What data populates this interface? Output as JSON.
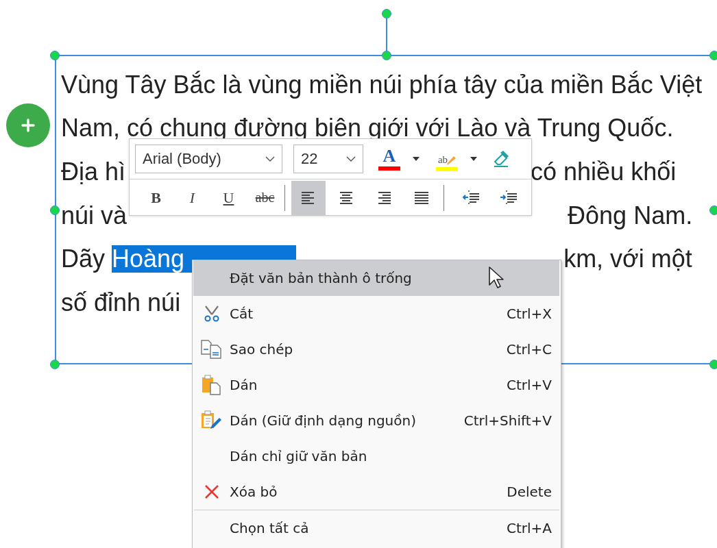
{
  "text_box": {
    "lines": [
      {
        "segments": [
          {
            "text": "Vùng Tây Bắc là vùng miền núi phía tây của miền Bắc Việt",
            "selected": false
          }
        ]
      },
      {
        "segments": [
          {
            "text": "Nam, có chung đường biên giới với Lào và Trung Quốc.",
            "selected": false
          }
        ]
      },
      {
        "segments": [
          {
            "text": "Địa hì",
            "selected": false
          },
          {
            "text": "có nhiều khối",
            "selected": false
          }
        ]
      },
      {
        "segments": [
          {
            "text": "núi và",
            "selected": false
          },
          {
            "text": "Đông Nam.",
            "selected": false
          }
        ]
      },
      {
        "segments": [
          {
            "text": "Dãy ",
            "selected": false
          },
          {
            "text": "Hoàng",
            "selected": true
          },
          {
            "text": "km, với một",
            "selected": false
          }
        ]
      },
      {
        "segments": [
          {
            "text": "số đỉnh núi",
            "selected": false
          }
        ]
      }
    ]
  },
  "toolbar": {
    "font": {
      "value": "Arial (Body)"
    },
    "size": {
      "value": "22"
    },
    "color_buttons": [
      {
        "kind": "font-color",
        "label": "A",
        "color": "#ff0000"
      },
      {
        "kind": "highlight",
        "label": "ab",
        "color": "#ffff00"
      },
      {
        "kind": "clear-format"
      }
    ],
    "format_buttons": [
      {
        "kind": "bold",
        "label": "B"
      },
      {
        "kind": "italic",
        "label": "I"
      },
      {
        "kind": "underline",
        "label": "U"
      },
      {
        "kind": "strikethrough",
        "label": "abc"
      }
    ],
    "align_buttons": [
      {
        "kind": "left",
        "selected": true
      },
      {
        "kind": "center",
        "selected": false
      },
      {
        "kind": "right",
        "selected": false
      },
      {
        "kind": "justify",
        "selected": false
      }
    ],
    "indent_buttons": [
      {
        "kind": "outdent"
      },
      {
        "kind": "indent"
      }
    ]
  },
  "context_menu": {
    "items": [
      {
        "kind": "none",
        "label": "Đặt văn bản thành ô trống",
        "selected": true
      },
      {
        "kind": "cut",
        "label": "Cắt",
        "shortcut": "Ctrl+X",
        "selected": false
      },
      {
        "kind": "copy",
        "label": "Sao chép",
        "shortcut": "Ctrl+C",
        "selected": false
      },
      {
        "kind": "paste",
        "label": "Dán",
        "shortcut": "Ctrl+V",
        "selected": false
      },
      {
        "kind": "paste-format",
        "label": "Dán (Giữ định dạng nguồn)",
        "shortcut": "Ctrl+Shift+V",
        "selected": false
      },
      {
        "kind": "none",
        "label": "Dán chỉ giữ văn bản",
        "selected": false
      },
      {
        "kind": "delete",
        "label": "Xóa bỏ",
        "shortcut": "Delete",
        "selected": false
      },
      {
        "kind": "separator"
      },
      {
        "kind": "none",
        "label": "Chọn tất cả",
        "shortcut": "Ctrl+A",
        "selected": false
      }
    ]
  }
}
